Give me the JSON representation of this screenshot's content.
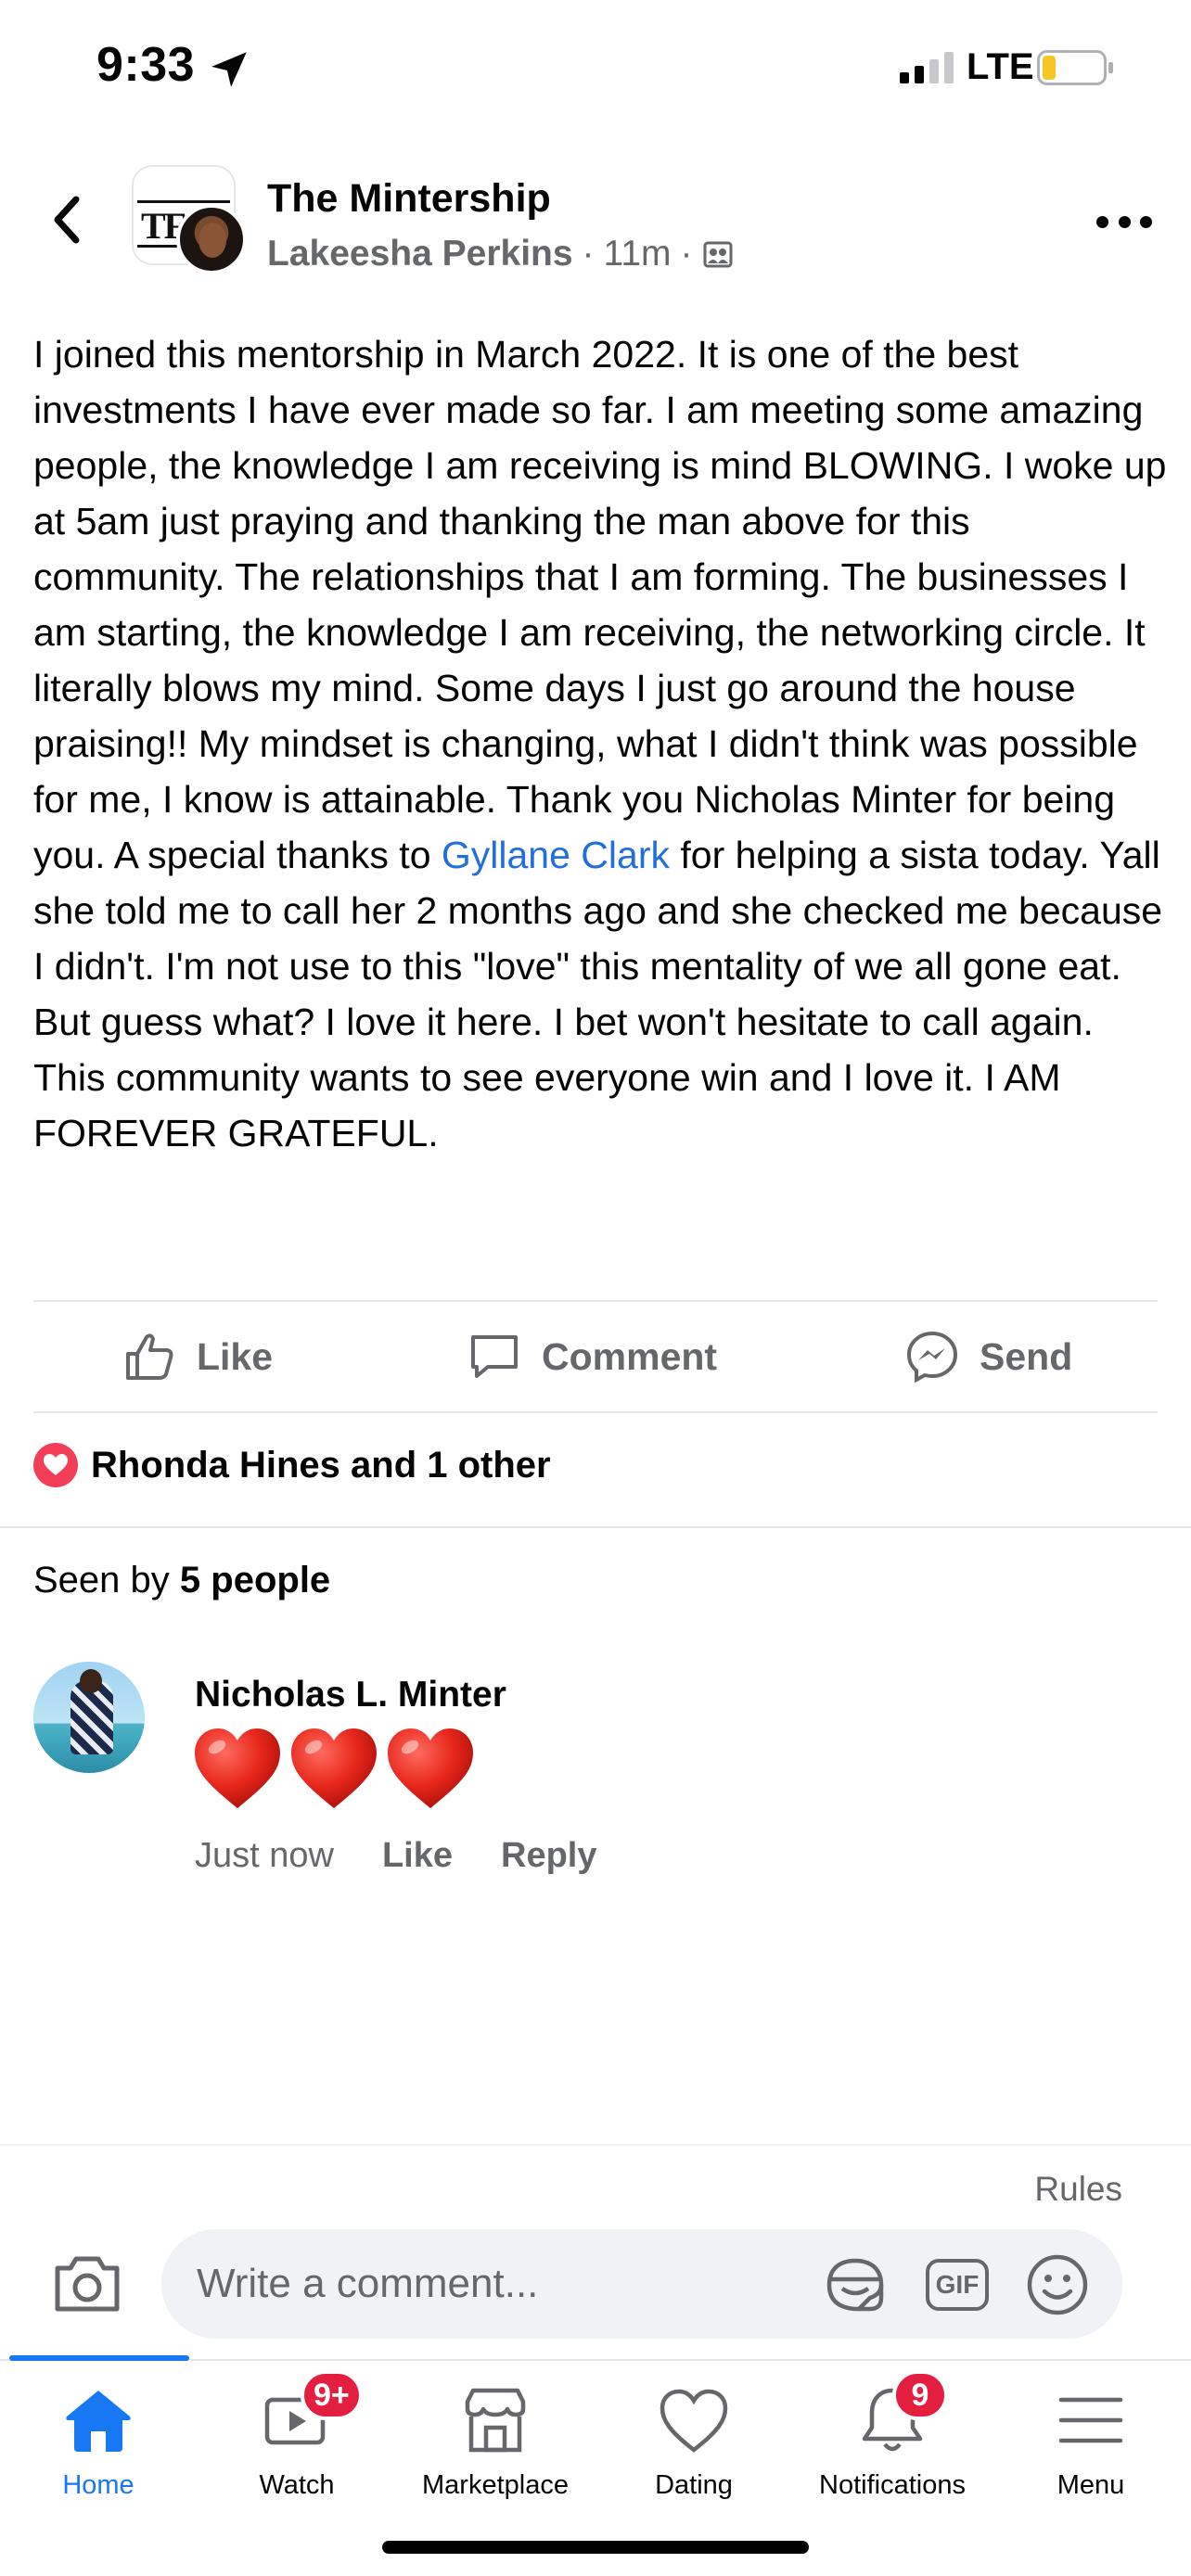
{
  "status_bar": {
    "time": "9:33",
    "network": "LTE"
  },
  "post": {
    "group_name": "The Mintership",
    "group_logo_text": "TF",
    "author": "Lakeesha Perkins",
    "time_ago": "11m",
    "separator": "·",
    "text_before_mention": "I joined this mentorship in March 2022. It is one of the best investments I have ever made so far. I am meeting some amazing people, the knowledge I am receiving is mind BLOWING. I woke up at 5am just praying and thanking the man above for this community. The relationships that I am forming. The businesses I am starting, the knowledge I am receiving, the networking circle. It literally blows my mind. Some days I just go around the house praising!! My mindset is changing, what I didn't think was possible for me,  I know is attainable. Thank you Nicholas Minter for being you. A special thanks to ",
    "mention": "Gyllane Clark",
    "text_after_mention": " for helping a sista today. Yall she told me to call her 2 months ago and she checked me because I didn't. I'm not use to this \"love\" this mentality of we all gone eat. But guess what? I love it here. I bet won't hesitate to call again. This community wants to see everyone win and I love it. I AM FOREVER GRATEFUL.",
    "actions": {
      "like": "Like",
      "comment": "Comment",
      "send": "Send"
    },
    "reactions_summary": "Rhonda Hines and 1 other",
    "seen_by_prefix": "Seen by",
    "seen_by_count": "5 people"
  },
  "comment": {
    "name": "Nicholas L. Minter",
    "content_icons": [
      "heart-emoji",
      "heart-emoji",
      "heart-emoji"
    ],
    "time": "Just now",
    "like": "Like",
    "reply": "Reply"
  },
  "composer": {
    "rules": "Rules",
    "placeholder": "Write a comment...",
    "gif": "GIF"
  },
  "tabs": [
    {
      "label": "Home",
      "icon": "home-icon",
      "active": true
    },
    {
      "label": "Watch",
      "icon": "watch-icon",
      "badge": "9+"
    },
    {
      "label": "Marketplace",
      "icon": "marketplace-icon"
    },
    {
      "label": "Dating",
      "icon": "dating-icon"
    },
    {
      "label": "Notifications",
      "icon": "bell-icon",
      "badge": "9"
    },
    {
      "label": "Menu",
      "icon": "menu-icon"
    }
  ],
  "colors": {
    "accent": "#1877f2",
    "mention": "#216fdb",
    "badge": "#e41e3f",
    "heart": "#f33e58",
    "secondary_text": "#65676b"
  }
}
